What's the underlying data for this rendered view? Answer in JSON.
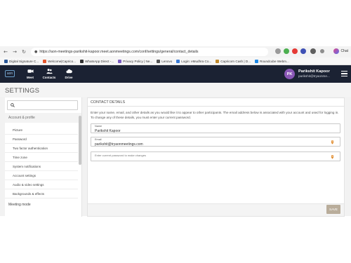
{
  "browser": {
    "url": "https://aon-meetings-parikshit-kapoor.meet.aonmeetings.com/conf/settings/general/contact_details",
    "chat_label": "Chat",
    "bookmarks": [
      {
        "label": "Digital Signature C...",
        "color": "#2b5797"
      },
      {
        "label": "Welcome|Caprico...",
        "color": "#e4572e"
      },
      {
        "label": "WhatsApp Direct -...",
        "color": "#333333"
      },
      {
        "label": "Privacy Policy | Ne...",
        "color": "#7a5cc1"
      },
      {
        "label": "Lenovo",
        "color": "#555555"
      },
      {
        "label": "Login: eMudhra Co...",
        "color": "#3a7bd5"
      },
      {
        "label": "Capricorn Cash | D...",
        "color": "#c08a2e"
      },
      {
        "label": "Roundcube Webm...",
        "color": "#1e88e5"
      }
    ]
  },
  "appbar": {
    "logo_text": "aon",
    "nav": [
      {
        "label": "Meet",
        "icon": "video-camera-icon"
      },
      {
        "label": "Contacts",
        "icon": "contacts-icon"
      },
      {
        "label": "Drive",
        "icon": "cloud-icon"
      }
    ],
    "avatar_initials": "PK",
    "user_name": "Parikshit Kapoor",
    "user_email": "parikshit@tryaonme..."
  },
  "settings": {
    "title": "SETTINGS",
    "search_icon": "search-icon",
    "section": "Account & profile",
    "items": [
      "Picture",
      "Password",
      "Two factor authentication",
      "Time zone",
      "System notifications",
      "Account settings",
      "Audio & video settings",
      "Backgrounds & effects"
    ],
    "section2": "Meeting mode"
  },
  "contact": {
    "heading": "CONTACT DETAILS",
    "description": "Enter your name, email, and other details as you would like it to appear to other participants. The email address below is associated with your account and used for logging in. To change any of these details, you must enter your current password.",
    "name_label": "Name",
    "name_value": "Parikshit Kapoor",
    "email_label": "Email",
    "email_value": "parikshit@tryaonmeetings.com",
    "password_placeholder": "Enter current password to make changes",
    "save_label": "SAVE"
  },
  "colors": {
    "header_bg": "#1b2233",
    "avatar_bg": "#8a57b6",
    "save_bg": "#b9ad9b",
    "password_tag": "#e08a2a"
  }
}
